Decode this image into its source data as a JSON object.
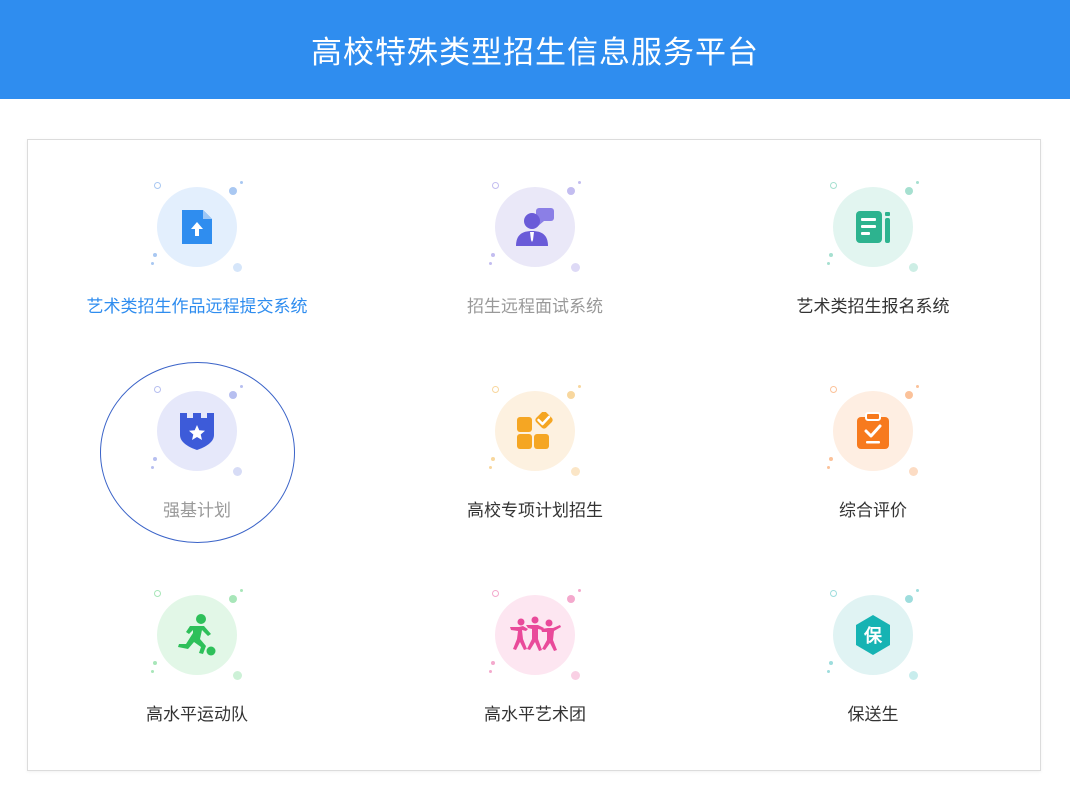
{
  "header": {
    "title": "高校特殊类型招生信息服务平台"
  },
  "tiles": [
    {
      "label": "艺术类招生作品远程提交系统",
      "icon": "file-upload-icon",
      "label_color": "#2f8def",
      "bg": "#e3effd",
      "accent": "#2f8def"
    },
    {
      "label": "招生远程面试系统",
      "icon": "interview-icon",
      "label_color": "#999999",
      "bg": "#eae8f8",
      "accent": "#6a5bd8"
    },
    {
      "label": "艺术类招生报名系统",
      "icon": "registration-form-icon",
      "label_color": "#333333",
      "bg": "#e2f5f0",
      "accent": "#2db38f"
    },
    {
      "label": "强基计划",
      "icon": "shield-star-icon",
      "label_color": "#999999",
      "bg": "#e6e8fa",
      "accent": "#3d5bd9"
    },
    {
      "label": "高校专项计划招生",
      "icon": "blocks-check-icon",
      "label_color": "#333333",
      "bg": "#fdf1e0",
      "accent": "#f5a623"
    },
    {
      "label": "综合评价",
      "icon": "clipboard-check-icon",
      "label_color": "#333333",
      "bg": "#feeee2",
      "accent": "#f77a1e"
    },
    {
      "label": "高水平运动队",
      "icon": "soccer-player-icon",
      "label_color": "#333333",
      "bg": "#e2f7e7",
      "accent": "#2ec05a"
    },
    {
      "label": "高水平艺术团",
      "icon": "dancers-icon",
      "label_color": "#333333",
      "bg": "#fde6f1",
      "accent": "#e94a9a"
    },
    {
      "label": "保送生",
      "icon": "recommend-badge-icon",
      "label_color": "#333333",
      "bg": "#e0f3f3",
      "accent": "#16b3b3",
      "icon_text": "保"
    }
  ]
}
